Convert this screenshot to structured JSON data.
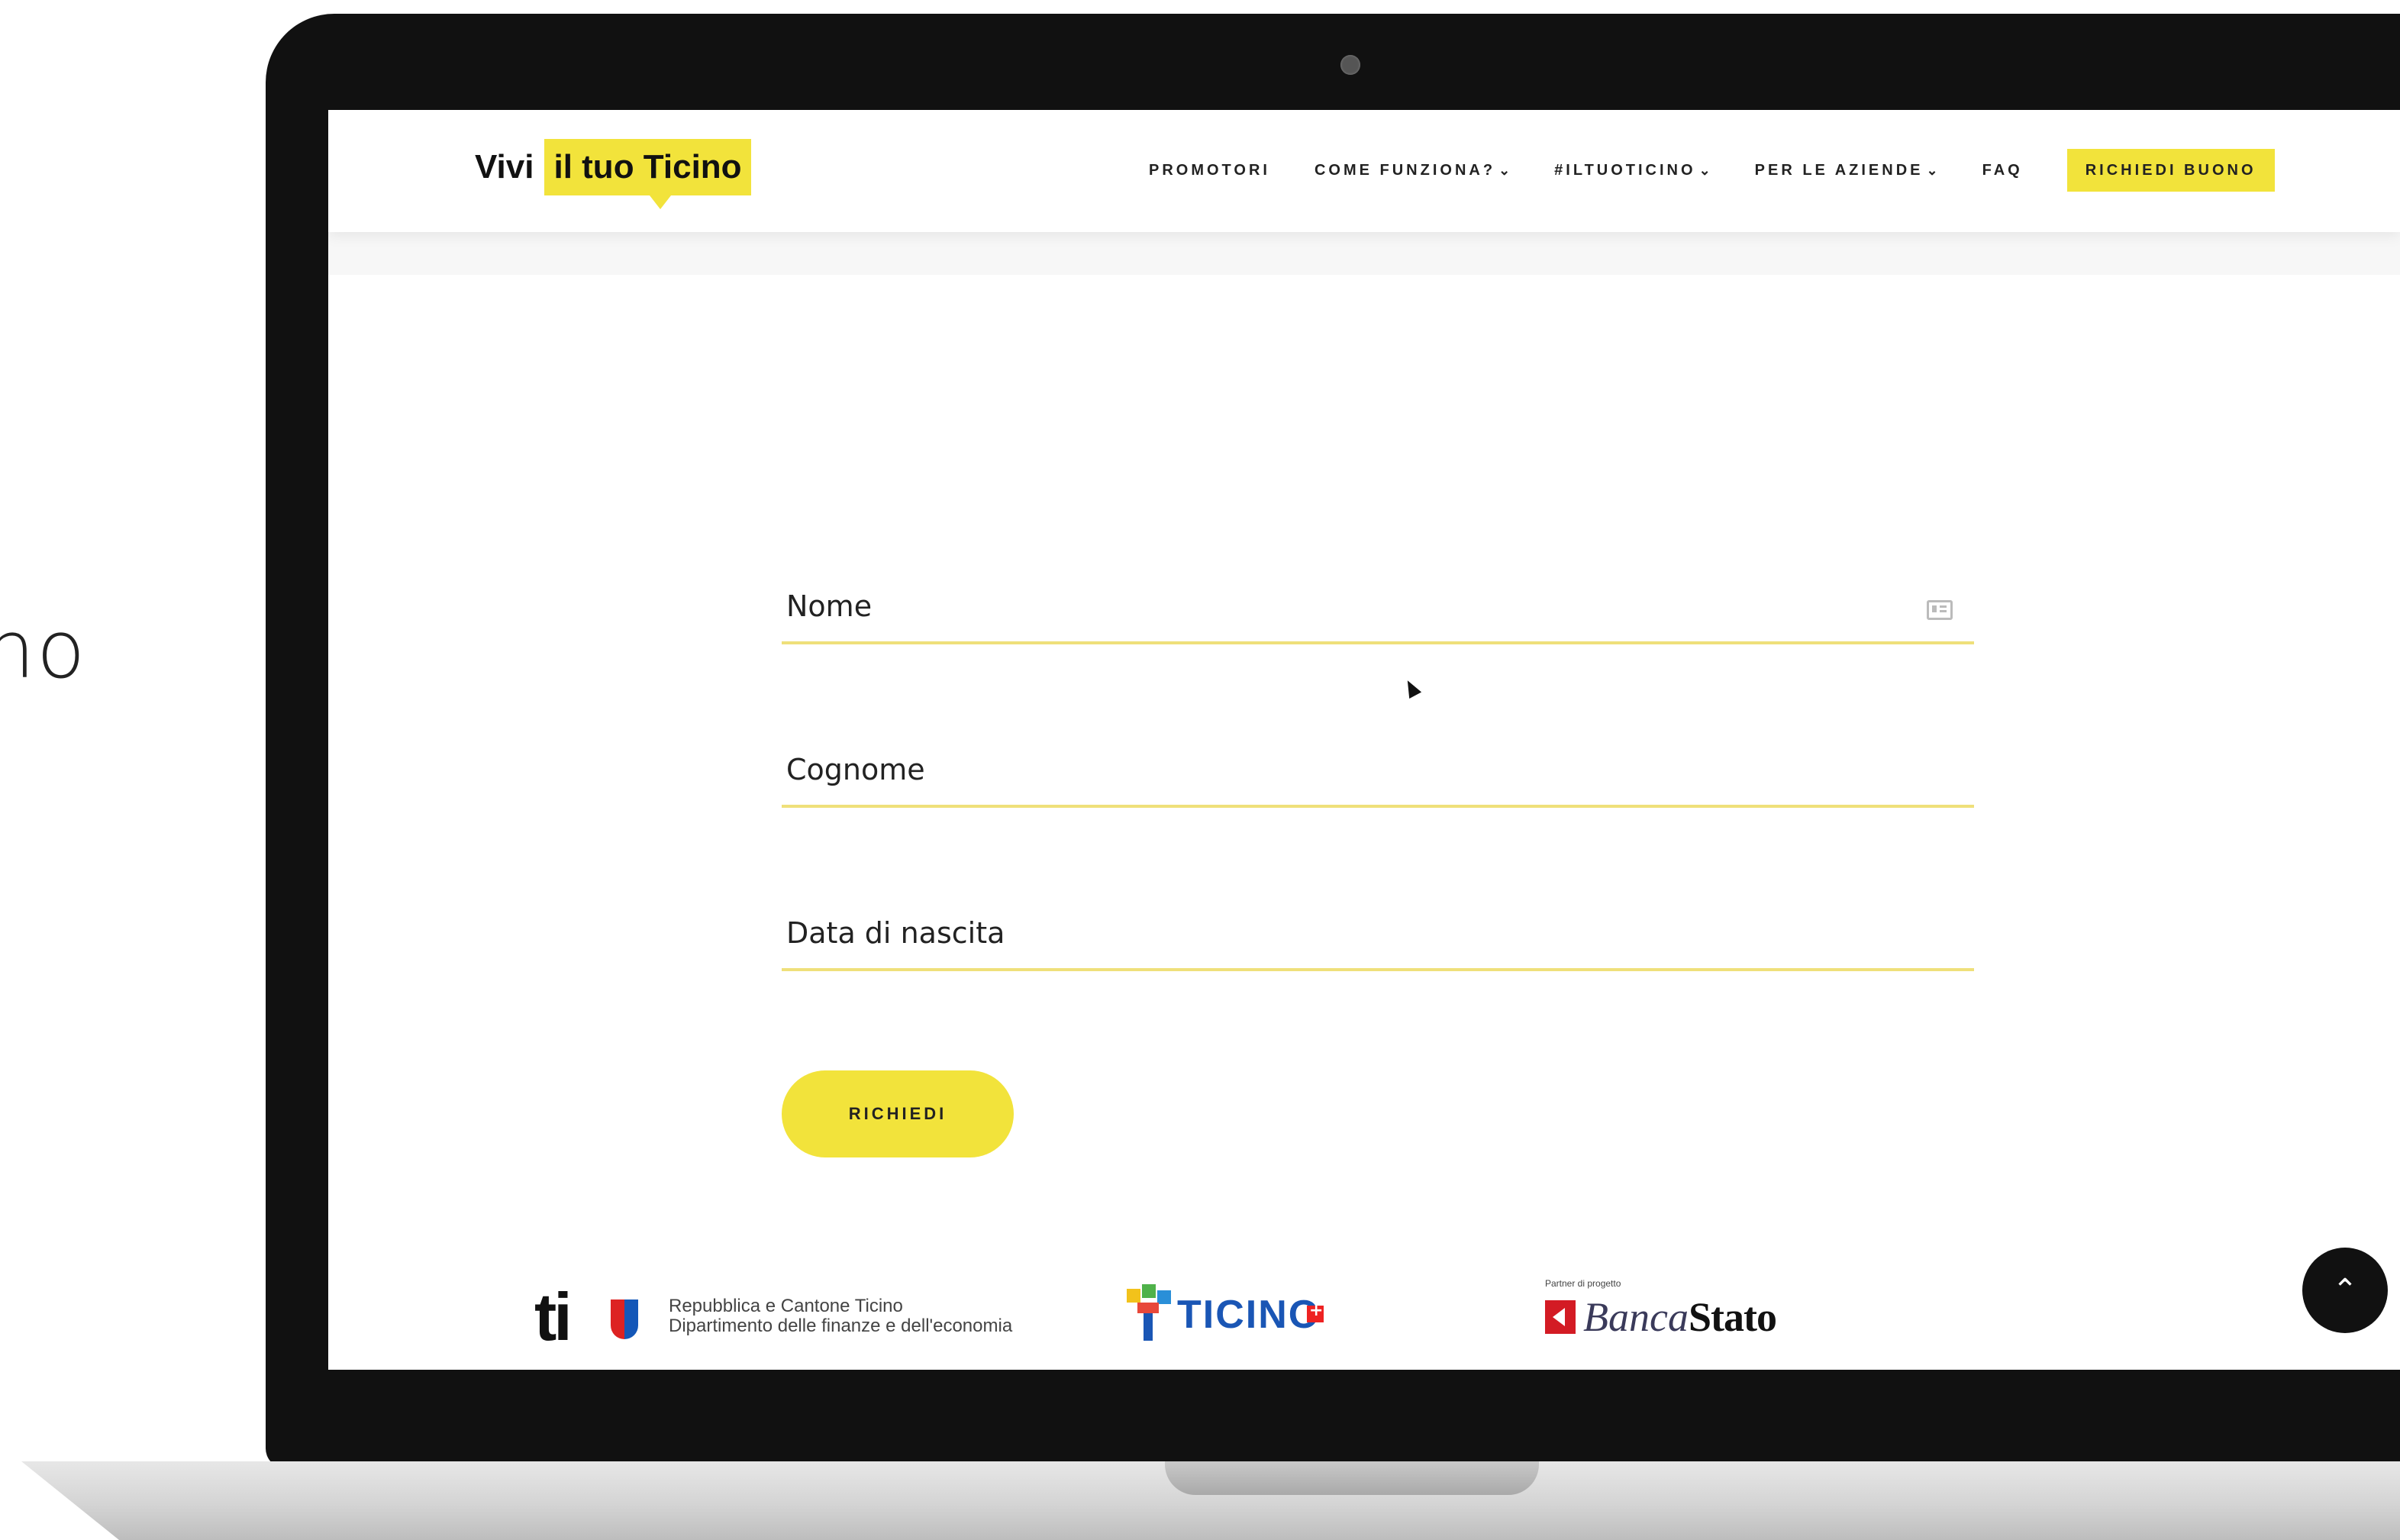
{
  "background_text": "no",
  "header": {
    "logo_part1": "Vivi",
    "logo_part2": "il tuo Ticino",
    "nav": [
      {
        "label": "PROMOTORI",
        "has_chevron": false
      },
      {
        "label": "COME FUNZIONA?",
        "has_chevron": true
      },
      {
        "label": "#ILTUOTICINO",
        "has_chevron": true
      },
      {
        "label": "PER LE AZIENDE",
        "has_chevron": true
      },
      {
        "label": "FAQ",
        "has_chevron": false
      }
    ],
    "cta_label": "RICHIEDI BUONO",
    "chevron": "⌄"
  },
  "form": {
    "fields": [
      {
        "label": "Nome",
        "icon": "id-card-icon"
      },
      {
        "label": "Cognome"
      },
      {
        "label": "Data di nascita"
      }
    ],
    "submit_label": "RICHIEDI"
  },
  "footer": {
    "ti_logo": "ti",
    "rep_line1": "Repubblica e Cantone Ticino",
    "rep_line2": "Dipartimento delle finanze e dell'economia",
    "ticino_logo": "TICINO",
    "partner_label": "Partner di progetto",
    "banca_part1": "Banca",
    "banca_part2": "Stato"
  },
  "scroll_top_icon": "⌃",
  "colors": {
    "accent": "#f2e33b",
    "field_line": "#efe07a",
    "bezel": "#111111"
  }
}
